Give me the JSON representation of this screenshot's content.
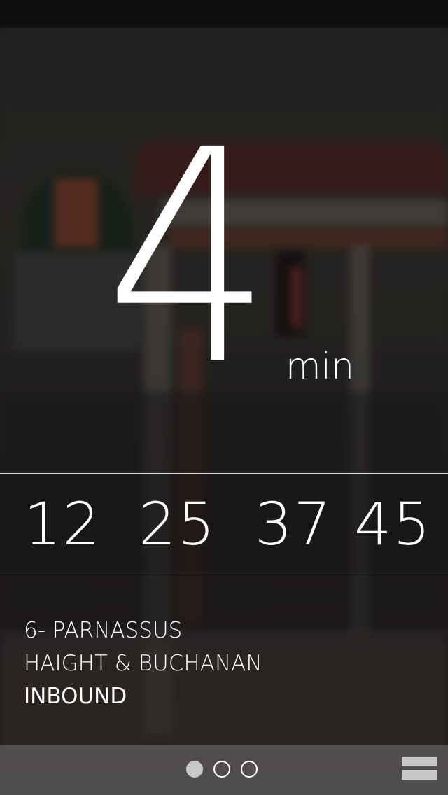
{
  "arrival": {
    "minutes": "4",
    "unit": "min"
  },
  "upcoming_times": [
    "12",
    "25",
    "37",
    "45"
  ],
  "route": {
    "name": "6- PARNASSUS",
    "stop": "HAIGHT & BUCHANAN",
    "direction": "INBOUND"
  },
  "pager": {
    "page_count": 3,
    "active_index": 0
  },
  "menu_icon": "hamburger-menu-icon"
}
